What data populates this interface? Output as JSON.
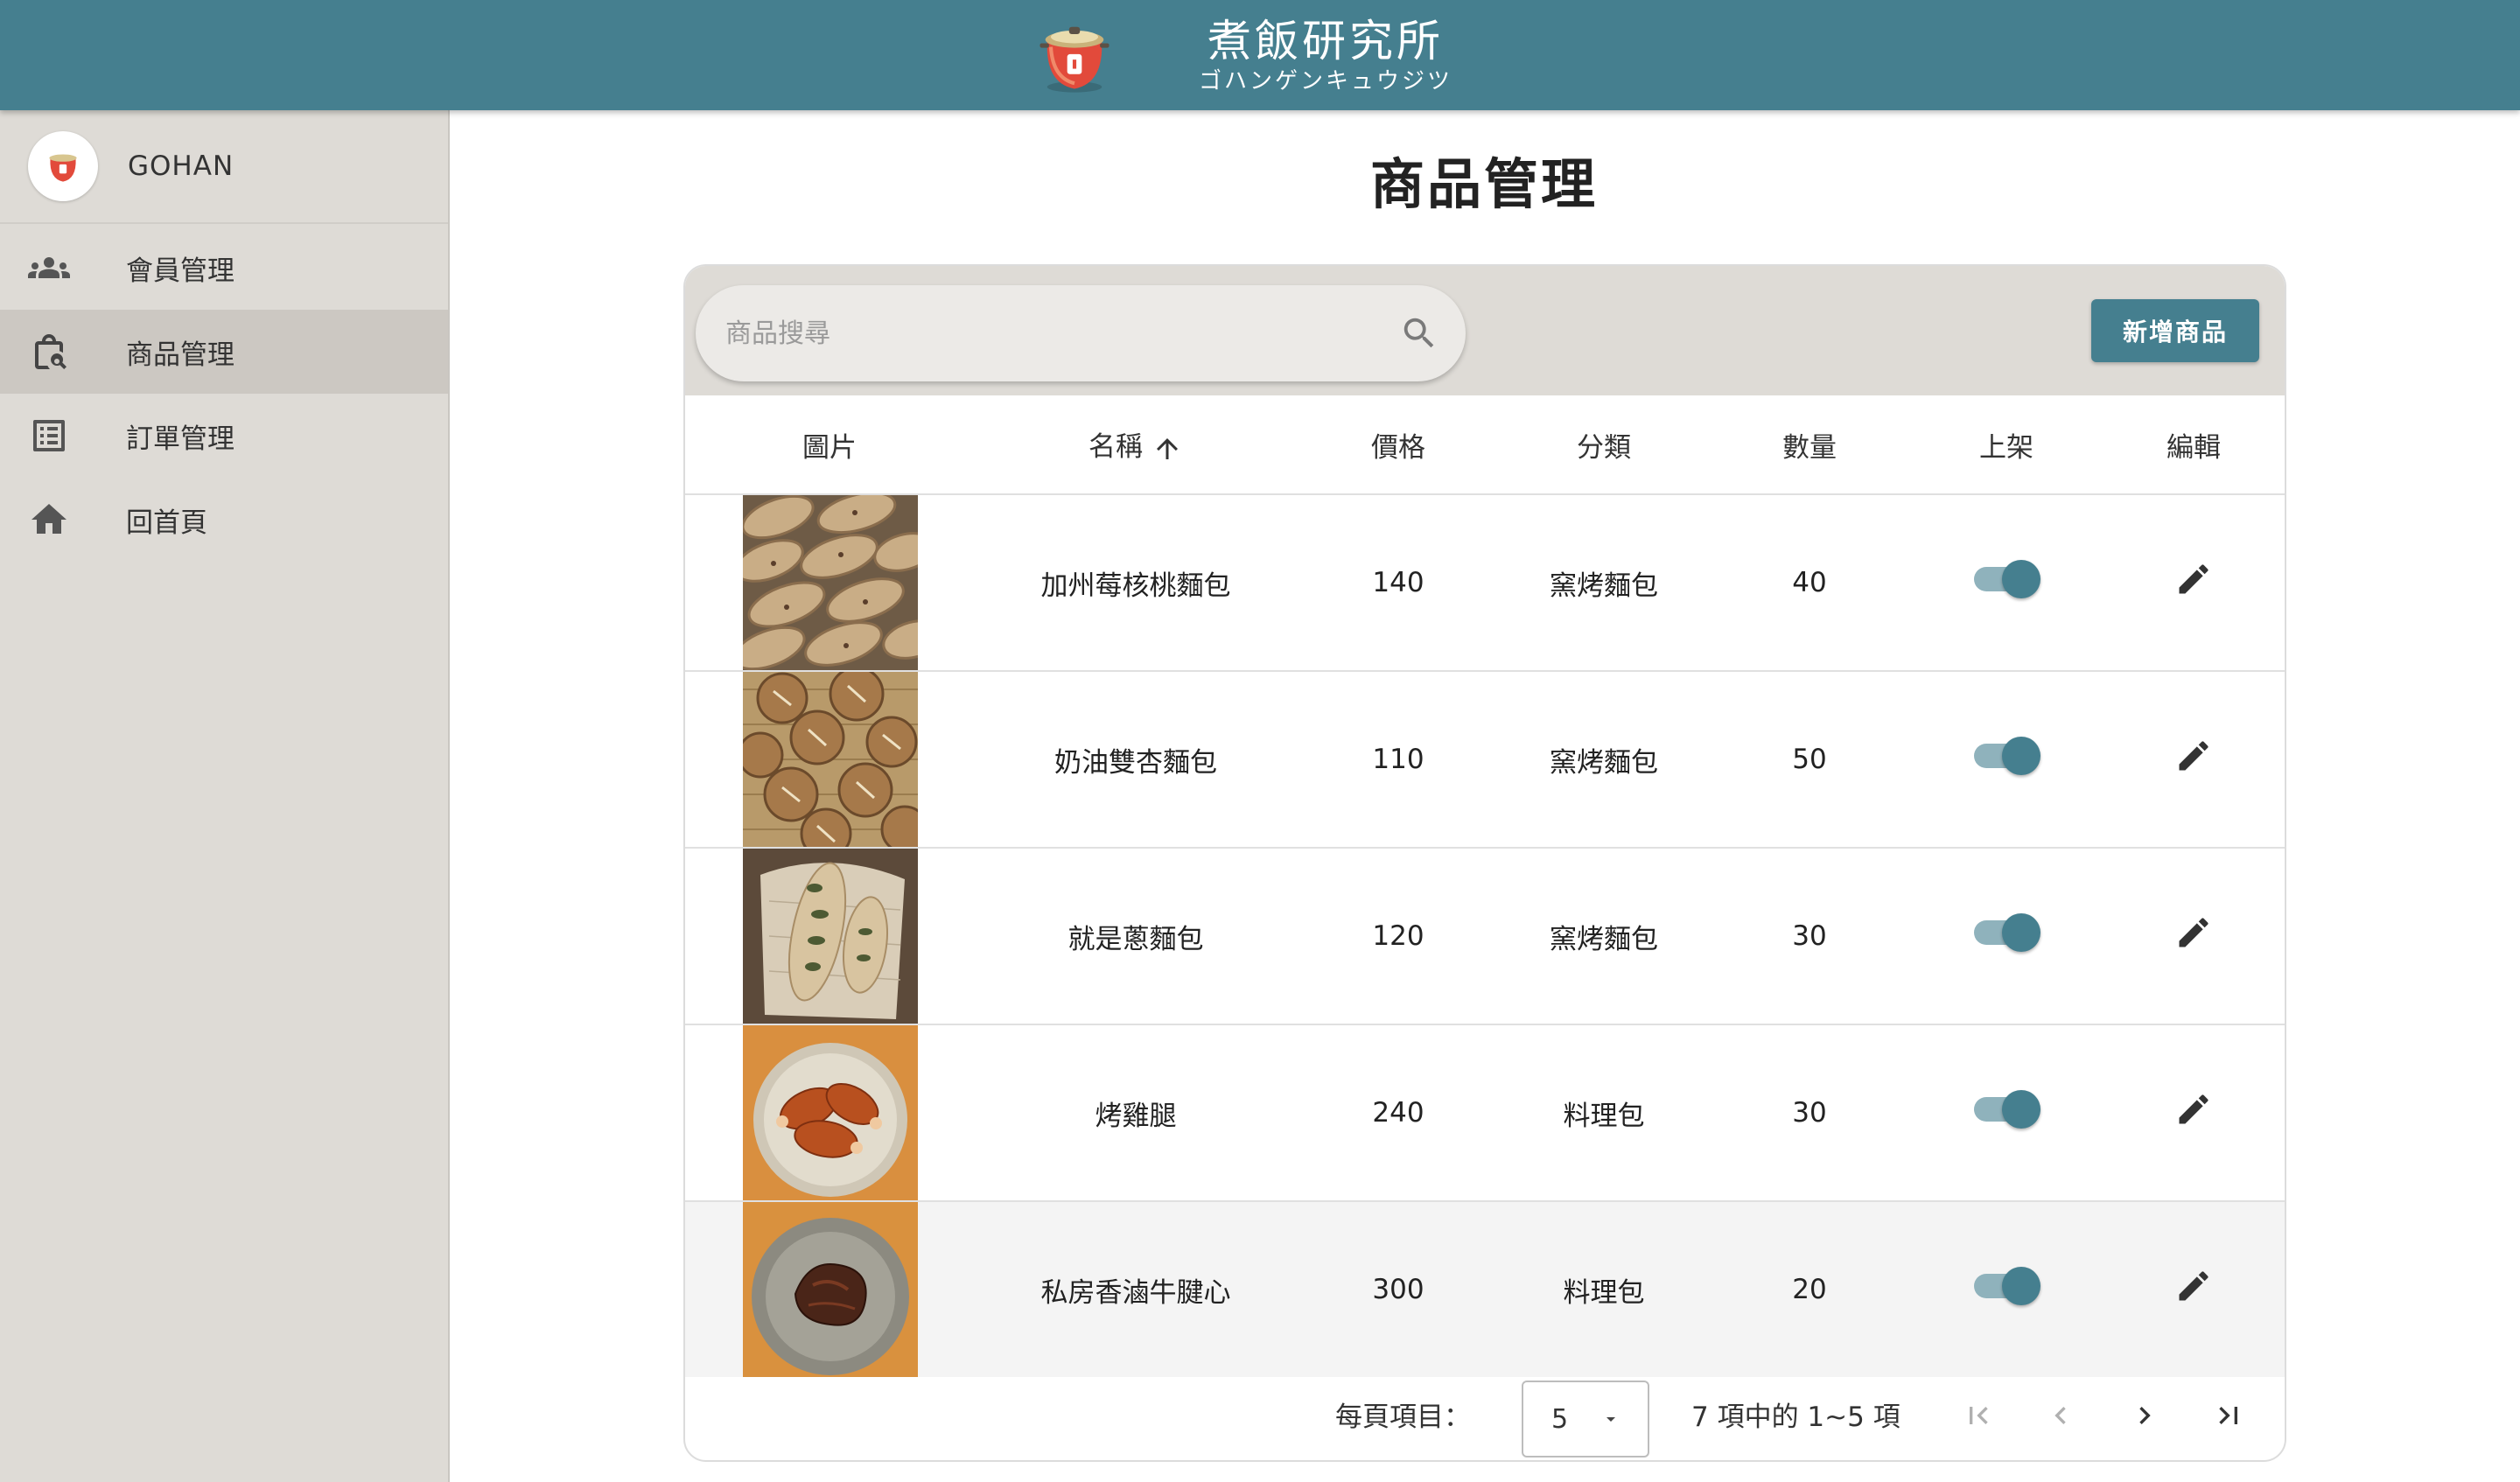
{
  "header": {
    "brand_title": "煮飯研究所",
    "brand_subtitle": "ゴハンゲンキュウジツ",
    "background": "#457f8f"
  },
  "sidebar": {
    "profile_name": "GOHAN",
    "items": [
      {
        "label": "會員管理",
        "icon": "people-icon",
        "active": false
      },
      {
        "label": "商品管理",
        "icon": "shopping-bag-search-icon",
        "active": true
      },
      {
        "label": "訂單管理",
        "icon": "list-icon",
        "active": false
      },
      {
        "label": "回首頁",
        "icon": "home-icon",
        "active": false
      }
    ]
  },
  "main": {
    "title": "商品管理",
    "search_placeholder": "商品搜尋",
    "add_button": "新增商品",
    "columns": [
      "圖片",
      "名稱",
      "價格",
      "分類",
      "數量",
      "上架",
      "編輯"
    ],
    "sorted_column": "名稱",
    "sort_direction": "ascending",
    "rows": [
      {
        "name": "加州莓核桃麵包",
        "price": "140",
        "category": "窯烤麵包",
        "qty": "40",
        "listed": true,
        "image": "bread-walnut"
      },
      {
        "name": "奶油雙杏麵包",
        "price": "110",
        "category": "窯烤麵包",
        "qty": "50",
        "listed": true,
        "image": "bread-round"
      },
      {
        "name": "就是蔥麵包",
        "price": "120",
        "category": "窯烤麵包",
        "qty": "30",
        "listed": true,
        "image": "bread-scallion"
      },
      {
        "name": "烤雞腿",
        "price": "240",
        "category": "料理包",
        "qty": "30",
        "listed": true,
        "image": "chicken-leg"
      },
      {
        "name": "私房香滷牛腱心",
        "price": "300",
        "category": "料理包",
        "qty": "20",
        "listed": true,
        "image": "braised-beef"
      }
    ],
    "pagination": {
      "per_page_label": "每頁項目：",
      "per_page_value": "5",
      "range_text": "7 項中的 1~5 項"
    }
  }
}
